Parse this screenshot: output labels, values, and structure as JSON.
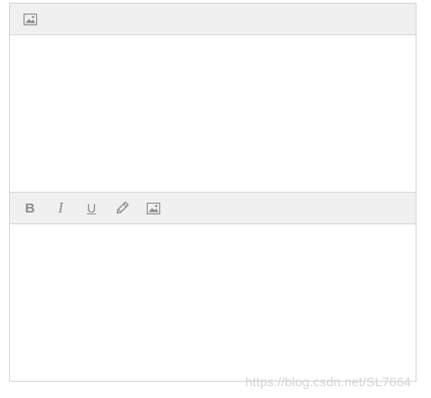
{
  "editors": [
    {
      "toolbar": {
        "buttons": [
          {
            "icon": "image-icon",
            "action": "insert image"
          }
        ]
      },
      "content": ""
    },
    {
      "toolbar": {
        "buttons": [
          {
            "icon": "bold-icon",
            "glyph": "B"
          },
          {
            "icon": "italic-icon",
            "glyph": "I"
          },
          {
            "icon": "underline-icon",
            "glyph": "U"
          },
          {
            "icon": "pen-icon"
          },
          {
            "icon": "image-icon"
          }
        ]
      },
      "content": ""
    }
  ],
  "watermark": "https://blog.csdn.net/SL7664",
  "colors": {
    "toolbar_bg": "#f0f0f0",
    "border": "#d6d6d6",
    "icon": "#8c8c8c",
    "watermark": "#d3d3d3"
  }
}
